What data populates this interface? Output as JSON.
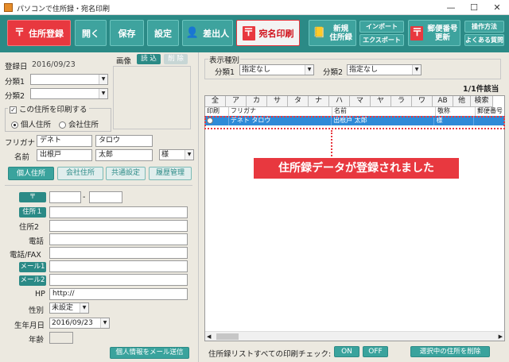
{
  "window": {
    "title": "パソコンで住所録・宛名印刷",
    "min": "—",
    "max": "☐",
    "close": "✕"
  },
  "toolbar": {
    "register": "住所登録",
    "open": "開く",
    "save": "保存",
    "settings": "設定",
    "sender": "差出人",
    "print": "宛名印刷",
    "new_book_1": "新規",
    "new_book_2": "住所録",
    "import": "インポート",
    "export": "エクスポート",
    "postal_1": "郵便番号",
    "postal_2": "更新",
    "howto": "操作方法",
    "faq": "よくある質問",
    "colors": {
      "teal": "#2b8a86",
      "red": "#e8383f"
    }
  },
  "form": {
    "reg_date_label": "登録日",
    "reg_date": "2016/09/23",
    "cat1_label": "分類1",
    "cat2_label": "分類2",
    "cat1_value": "",
    "cat2_value": "",
    "image_label": "画像",
    "load": "読 込",
    "delete": "削 除",
    "print_group": "この住所を印刷する",
    "personal": "個人住所",
    "company": "会社住所",
    "furigana_label": "フリガナ",
    "furigana_last": "デネト",
    "furigana_first": "タロウ",
    "name_label": "名前",
    "name_last": "出根戸",
    "name_first": "太郎",
    "honorific": "様",
    "tab_personal": "個人住所",
    "tab_company": "会社住所",
    "tab_common": "共通設定",
    "tab_history": "履歴管理",
    "postal_tag": "〒",
    "postal_dash": "-",
    "addr1": "住所１",
    "addr2": "住所2",
    "phone": "電話",
    "phone_fax": "電話/FAX",
    "mail1": "メール1",
    "mail2": "メール2",
    "hp": "HP",
    "hp_value": "http://",
    "gender": "性別",
    "gender_value": "未設定",
    "birth": "生年月日",
    "birth_value": "2016/09/23",
    "age": "年齢",
    "send_mail": "個人情報をメール送信"
  },
  "list": {
    "display_type": "表示種別",
    "cat1": "分類1",
    "cat2": "分類2",
    "cat1_value": "指定なし",
    "cat2_value": "指定なし",
    "count": "1/1件該当",
    "kana_headers": [
      "全",
      "ア",
      "カ",
      "サ",
      "タ",
      "ナ",
      "ハ",
      "マ",
      "ヤ",
      "ラ",
      "ワ",
      "AB",
      "他",
      "検索"
    ],
    "col_headers": [
      "印刷",
      "フリガナ",
      "名前",
      "敬称",
      "郵便番号"
    ],
    "row": {
      "furigana": "デネト タロウ",
      "name": "出根戸 太郎",
      "honorific": "様"
    },
    "toast": "住所録データが登録されました",
    "print_check": "住所録リストすべての印刷チェック:",
    "on": "ON",
    "off": "OFF",
    "delete_selected": "選択中の住所を削除"
  }
}
